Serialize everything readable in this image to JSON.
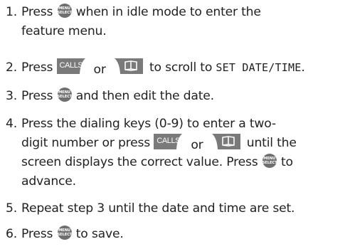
{
  "steps": [
    {
      "number": "1.",
      "line1_a": "Press ",
      "line1_b": " when in idle mode to enter the",
      "line2": "feature menu."
    },
    {
      "number": "2.",
      "line1_a": "Press ",
      "line1_or": "or",
      "line1_b": " to scroll to ",
      "line1_setting": "SET DATE/TIME",
      "line1_end": "."
    },
    {
      "number": "3.",
      "line1_a": "Press ",
      "line1_b": " and then edit the date."
    },
    {
      "number": "4.",
      "line1": "Press the dialing keys (0-9) to enter a two-",
      "line2_a": "digit number or press ",
      "line2_or": "or",
      "line2_b": " until the",
      "line3_a": "screen displays the correct value. Press ",
      "line3_b": " to",
      "line4": "advance."
    },
    {
      "number": "5.",
      "line1": "Repeat step 3 until the date and time are set."
    },
    {
      "number": "6.",
      "line1_a": "Press ",
      "line1_b": " to save."
    }
  ],
  "keys": {
    "menu_top": "MENU",
    "menu_bottom": "SELECT",
    "calls": "CALLS",
    "menu_icon": "menu-select-button-icon",
    "calls_icon": "calls-key-icon",
    "book_icon": "phonebook-key-icon"
  },
  "colors": {
    "text": "#222222",
    "menu_button": "#6f6f6f",
    "calls_key": "#7a7a7a",
    "book_key": "#7a7a7a"
  }
}
